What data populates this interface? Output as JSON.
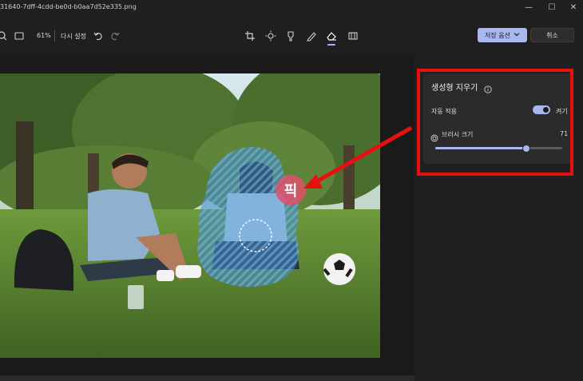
{
  "window": {
    "title": "31640-7dff-4cdd-be0d-b0aa7d52e335.png",
    "minimize_glyph": "—",
    "maximize_glyph": "☐",
    "close_glyph": "✕"
  },
  "toolbar": {
    "zoom_level": "61%",
    "reset_label": "다시 설정",
    "save_options_label": "저장 옵션",
    "cancel_label": "취소",
    "tools": [
      "crop-icon",
      "adjust-icon",
      "markup-icon",
      "draw-icon",
      "erase-icon",
      "background-icon"
    ],
    "active_tool": "erase-icon"
  },
  "panel": {
    "title": "생성형 지우기",
    "auto_apply_label": "자동 적용",
    "auto_apply_state": "켜기",
    "brush_size_label": "브러시 크기",
    "brush_size_value": "71",
    "brush_size_fraction": 0.71
  },
  "image": {
    "watermark_text": "픽"
  },
  "colors": {
    "accent": "#a8b8ef",
    "highlight": "#e8100f",
    "erase_mask": "#3d8ed0"
  }
}
